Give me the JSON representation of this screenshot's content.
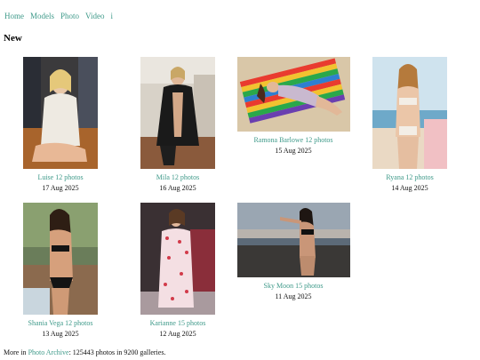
{
  "nav": {
    "home": "Home",
    "models": "Models",
    "photo": "Photo",
    "video": "Video",
    "info": "i"
  },
  "section_title": "New",
  "galleries": [
    {
      "name": "Luise",
      "count": "12 photos",
      "date": "17 Aug 2025"
    },
    {
      "name": "Mila",
      "count": "12 photos",
      "date": "16 Aug 2025"
    },
    {
      "name": "Ramona Barlowe",
      "count": "12 photos",
      "date": "15 Aug 2025"
    },
    {
      "name": "Ryana",
      "count": "12 photos",
      "date": "14 Aug 2025"
    },
    {
      "name": "Shania Vega",
      "count": "12 photos",
      "date": "13 Aug 2025"
    },
    {
      "name": "Karianne",
      "count": "15 photos",
      "date": "12 Aug 2025"
    },
    {
      "name": "Sky Moon",
      "count": "15 photos",
      "date": "11 Aug 2025"
    }
  ],
  "footer": {
    "prefix": "More in",
    "link": "Photo Archive",
    "suffix": ": 125443 photos in 9200 galleries."
  }
}
